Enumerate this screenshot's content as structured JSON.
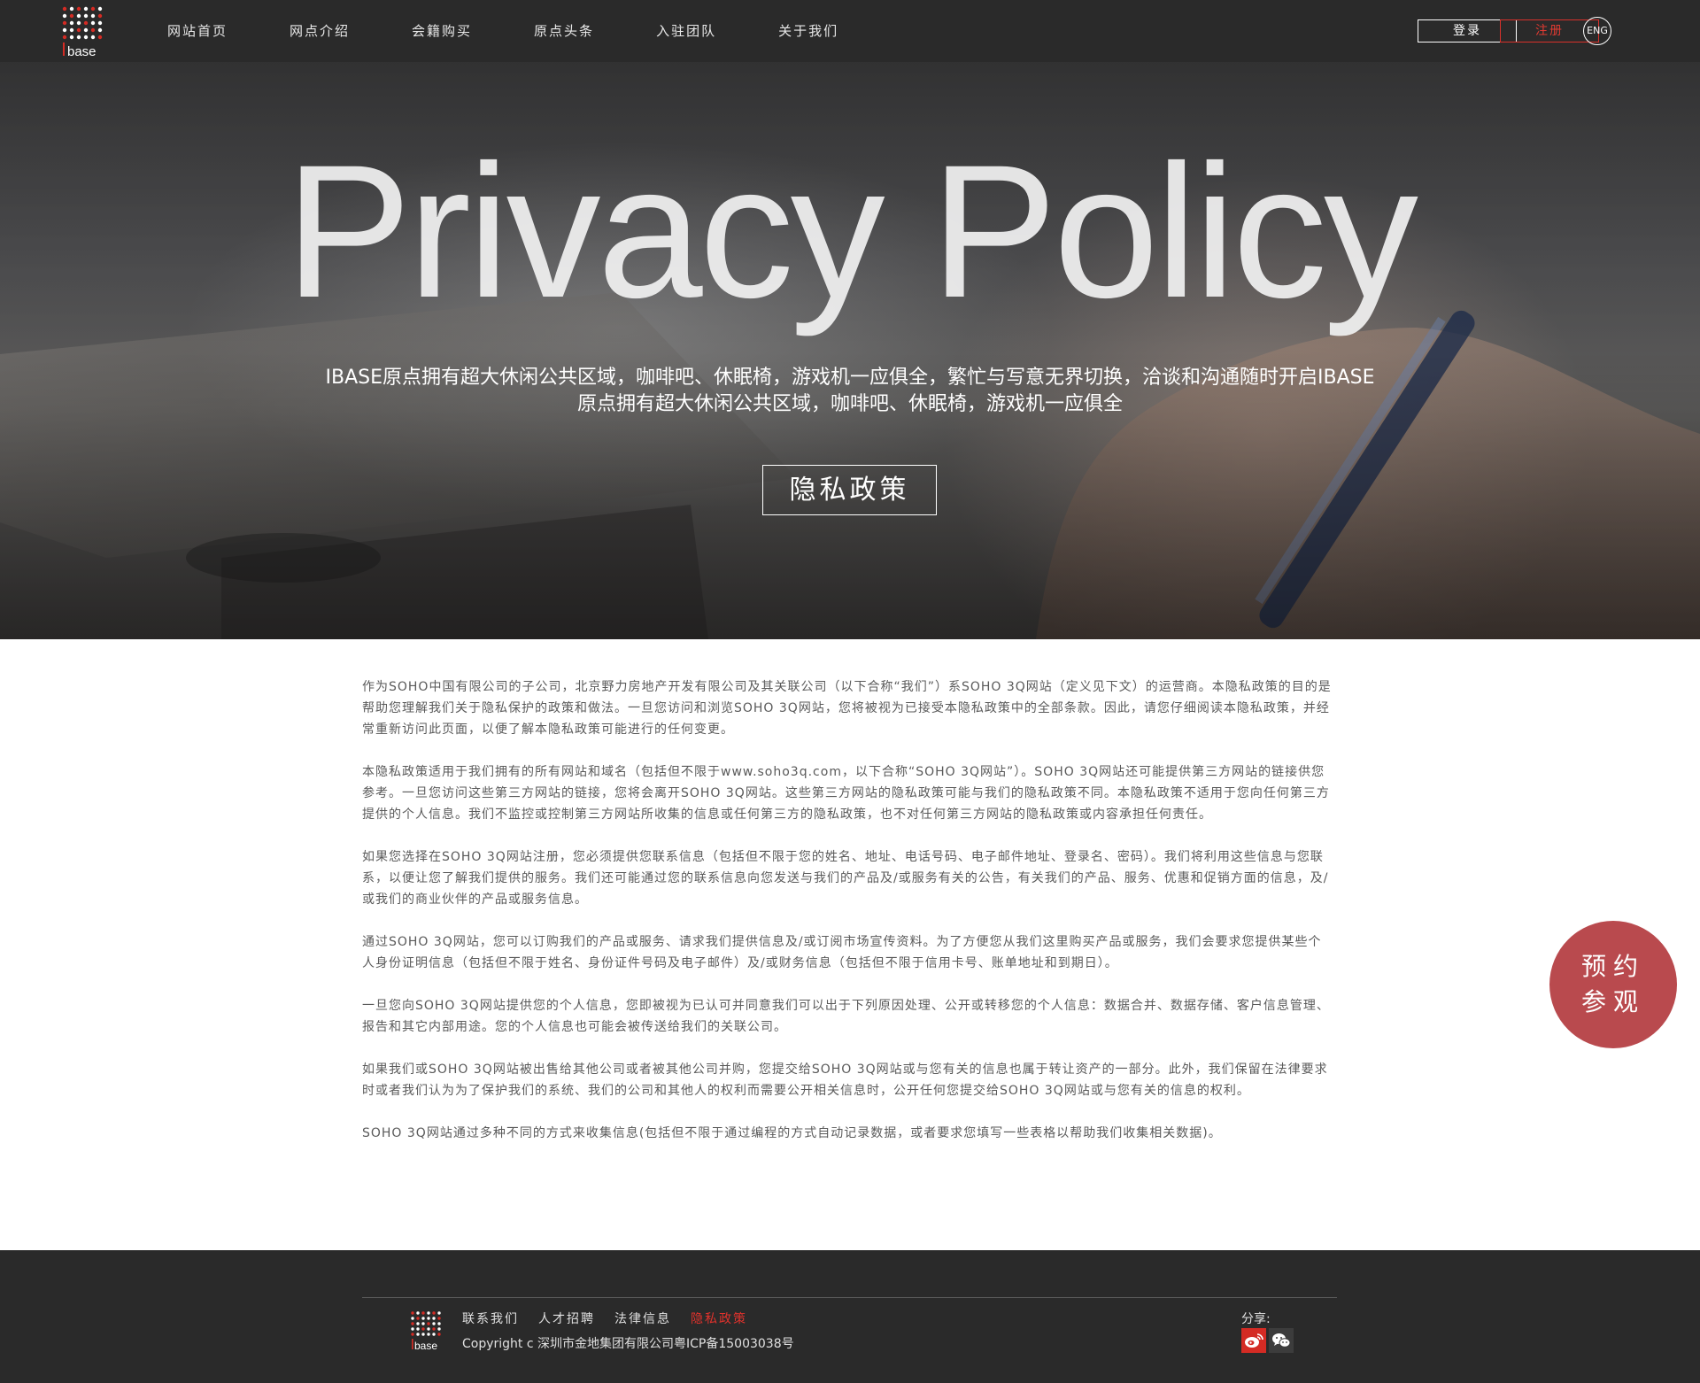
{
  "header": {
    "logo_text": "Ibase",
    "nav": [
      "网站首页",
      "网点介绍",
      "会籍购买",
      "原点头条",
      "入驻团队",
      "关于我们"
    ],
    "login_label": "登录",
    "register_label": "注册",
    "lang_label": "ENG"
  },
  "hero": {
    "title": "Privacy Policy",
    "subtitle_line1": "IBASE原点拥有超大休闲公共区域，咖啡吧、休眠椅，游戏机一应俱全，繁忙与写意无界切换，洽谈和沟通随时开启IBASE",
    "subtitle_line2": "原点拥有超大休闲公共区域，咖啡吧、休眠椅，游戏机一应俱全",
    "button_label": "隐私政策"
  },
  "content": {
    "paragraphs": [
      "作为SOHO中国有限公司的子公司，北京野力房地产开发有限公司及其关联公司（以下合称“我们”）系SOHO 3Q网站（定义见下文）的运营商。本隐私政策的目的是帮助您理解我们关于隐私保护的政策和做法。一旦您访问和浏览SOHO 3Q网站，您将被视为已接受本隐私政策中的全部条款。因此，请您仔细阅读本隐私政策，并经常重新访问此页面，以便了解本隐私政策可能进行的任何变更。",
      "本隐私政策适用于我们拥有的所有网站和域名（包括但不限于www.soho3q.com，以下合称“SOHO 3Q网站”）。SOHO 3Q网站还可能提供第三方网站的链接供您参考。一旦您访问这些第三方网站的链接，您将会离开SOHO 3Q网站。这些第三方网站的隐私政策可能与我们的隐私政策不同。本隐私政策不适用于您向任何第三方提供的个人信息。我们不监控或控制第三方网站所收集的信息或任何第三方的隐私政策，也不对任何第三方网站的隐私政策或内容承担任何责任。",
      "如果您选择在SOHO 3Q网站注册，您必须提供您联系信息（包括但不限于您的姓名、地址、电话号码、电子邮件地址、登录名、密码）。我们将利用这些信息与您联系，以便让您了解我们提供的服务。我们还可能通过您的联系信息向您发送与我们的产品及/或服务有关的公告，有关我们的产品、服务、优惠和促销方面的信息，及/或我们的商业伙伴的产品或服务信息。",
      "通过SOHO 3Q网站，您可以订购我们的产品或服务、请求我们提供信息及/或订阅市场宣传资料。为了方便您从我们这里购买产品或服务，我们会要求您提供某些个人身份证明信息（包括但不限于姓名、身份证件号码及电子邮件）及/或财务信息（包括但不限于信用卡号、账单地址和到期日）。",
      "一旦您向SOHO 3Q网站提供您的个人信息，您即被视为已认可并同意我们可以出于下列原因处理、公开或转移您的个人信息：数据合并、数据存储、客户信息管理、报告和其它内部用途。您的个人信息也可能会被传送给我们的关联公司。",
      "如果我们或SOHO 3Q网站被出售给其他公司或者被其他公司并购，您提交给SOHO 3Q网站或与您有关的信息也属于转让资产的一部分。此外，我们保留在法律要求时或者我们认为为了保护我们的系统、我们的公司和其他人的权利而需要公开相关信息时，公开任何您提交给SOHO 3Q网站或与您有关的信息的权利。",
      "SOHO 3Q网站通过多种不同的方式来收集信息(包括但不限于通过编程的方式自动记录数据，或者要求您填写一些表格以帮助我们收集相关数据)。"
    ]
  },
  "float_button": {
    "line1": "预约",
    "line2": "参观"
  },
  "footer": {
    "links": [
      "联系我们",
      "人才招聘",
      "法律信息",
      "隐私政策"
    ],
    "copyright": "Copyright c 深圳市金地集团有限公司粤ICP备15003038号",
    "share_label": "分享:",
    "share_icons": [
      "weibo-icon",
      "wechat-icon"
    ]
  },
  "colors": {
    "header_bg": "#2a2a2a",
    "accent_red": "#e0322c",
    "float_bg": "#b94a4e"
  }
}
